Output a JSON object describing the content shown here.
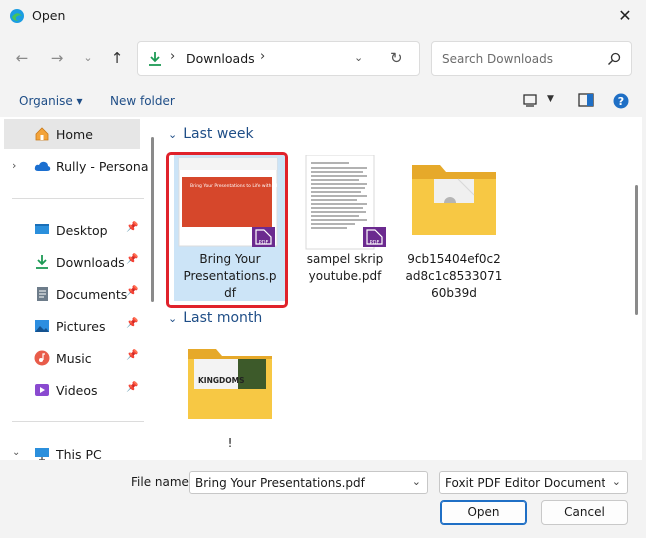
{
  "window": {
    "title": "Open"
  },
  "address": {
    "crumb": "Downloads",
    "separator": "›"
  },
  "search": {
    "placeholder": "Search Downloads"
  },
  "commands": {
    "organise": "Organise ▾",
    "new_folder": "New folder"
  },
  "sidebar": {
    "items": [
      {
        "label": "Home"
      },
      {
        "label": "Rully - Persona"
      },
      {
        "label": "Desktop"
      },
      {
        "label": "Downloads"
      },
      {
        "label": "Documents"
      },
      {
        "label": "Pictures"
      },
      {
        "label": "Music"
      },
      {
        "label": "Videos"
      },
      {
        "label": "This PC"
      }
    ]
  },
  "groups": [
    {
      "label": "Last week"
    },
    {
      "label": "Last month"
    }
  ],
  "files": [
    {
      "name": "Bring Your Presentations.pdf",
      "slide_title": "Bring Your Presentations to Life with AI",
      "badge": "PDF"
    },
    {
      "name": "sampel skrip youtube.pdf",
      "badge": "PDF"
    },
    {
      "name": "9cb15404ef0c2ad8c1c853307160b39d"
    },
    {
      "name": "!",
      "thumb_text": "KINGDOMS"
    }
  ],
  "bottom": {
    "file_name_label": "File name:",
    "file_name_value": "Bring Your Presentations.pdf",
    "file_type_value": "Foxit PDF Editor Document (*.p",
    "open_label": "Open",
    "cancel_label": "Cancel"
  },
  "colors": {
    "accent": "#1f6fc5",
    "highlight": "#e0222b",
    "selection": "#cce4f7",
    "folder": "#f7c844",
    "pdf_badge": "#6b2a8f",
    "slide": "#d6472b"
  }
}
